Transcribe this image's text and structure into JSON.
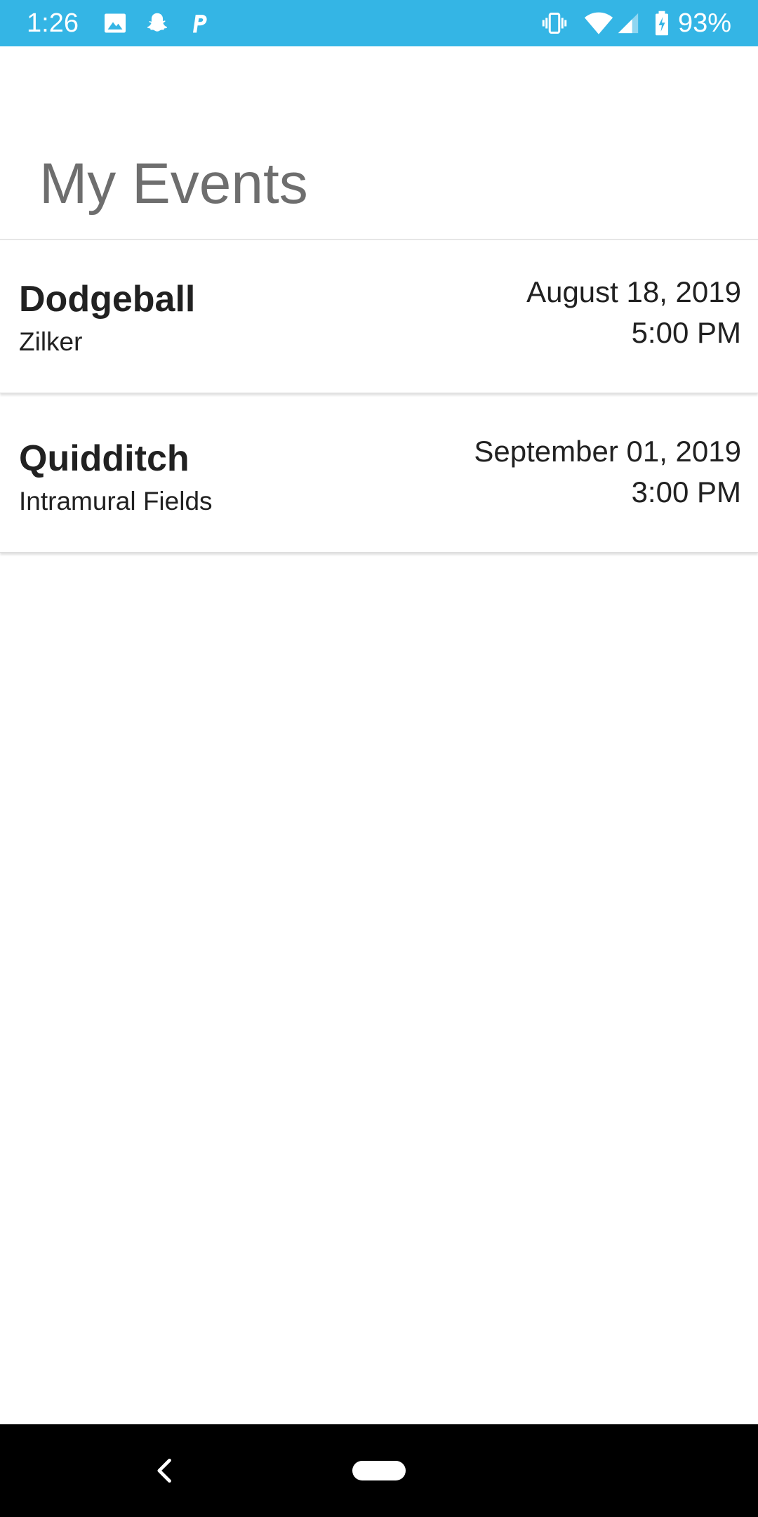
{
  "status_bar": {
    "time": "1:26",
    "battery_percent": "93%",
    "background_color": "#34b5e5",
    "left_icons": [
      "image-notification-icon",
      "snapchat-icon",
      "p-app-icon"
    ],
    "right_icons": [
      "vibrate-icon",
      "wifi-icon",
      "cell-signal-icon",
      "battery-charging-icon"
    ]
  },
  "header": {
    "title": "My Events"
  },
  "events": [
    {
      "name": "Dodgeball",
      "location": "Zilker",
      "date": "August 18, 2019",
      "time": "5:00 PM"
    },
    {
      "name": "Quidditch",
      "location": "Intramural Fields",
      "date": "September 01, 2019",
      "time": "3:00 PM"
    }
  ],
  "nav_bar": {
    "icons": [
      "back-icon",
      "home-pill-icon"
    ]
  }
}
